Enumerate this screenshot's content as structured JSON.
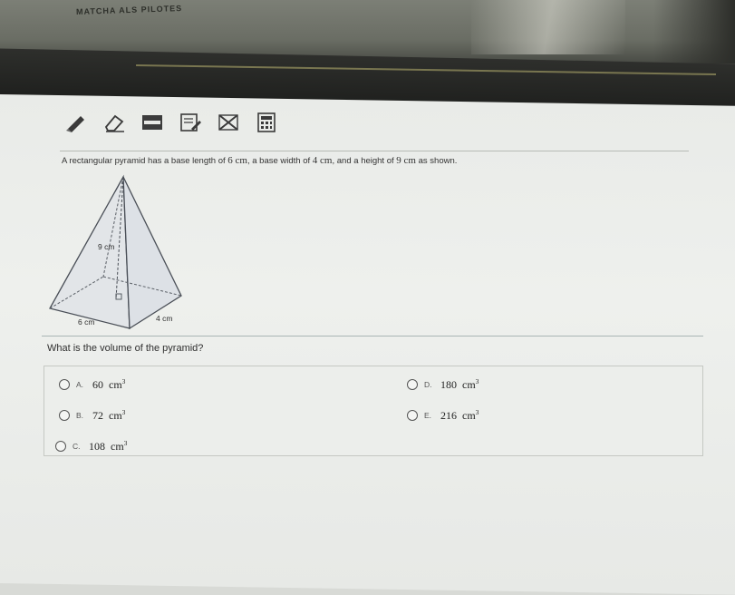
{
  "sticker": {
    "text": "MATCHA ALS PILOTES"
  },
  "toolbar": {
    "tools": [
      {
        "name": "pencil-icon"
      },
      {
        "name": "eraser-icon"
      },
      {
        "name": "line-reader-icon"
      },
      {
        "name": "notepad-icon"
      },
      {
        "name": "answer-eliminator-icon"
      },
      {
        "name": "calculator-icon"
      }
    ]
  },
  "question": {
    "part1": "A rectangular pyramid has a base length of ",
    "length": "6",
    "unit1": " cm",
    "part2": ", a base width of ",
    "width": "4",
    "unit2": " cm",
    "part3": ", and a height of ",
    "height": "9",
    "unit3": " cm",
    "part4": " as shown."
  },
  "figure": {
    "height_label": "9 cm",
    "length_label": "6 cm",
    "width_label": "4 cm"
  },
  "prompt": "What is the volume of the pyramid?",
  "choices": [
    {
      "letter": "A.",
      "value": "60",
      "unit": "cm",
      "exp": "3",
      "selected": false
    },
    {
      "letter": "B.",
      "value": "72",
      "unit": "cm",
      "exp": "3",
      "selected": false
    },
    {
      "letter": "C.",
      "value": "108",
      "unit": "cm",
      "exp": "3",
      "selected": false
    },
    {
      "letter": "D.",
      "value": "180",
      "unit": "cm",
      "exp": "3",
      "selected": false
    },
    {
      "letter": "E.",
      "value": "216",
      "unit": "cm",
      "exp": "3",
      "selected": false
    }
  ]
}
